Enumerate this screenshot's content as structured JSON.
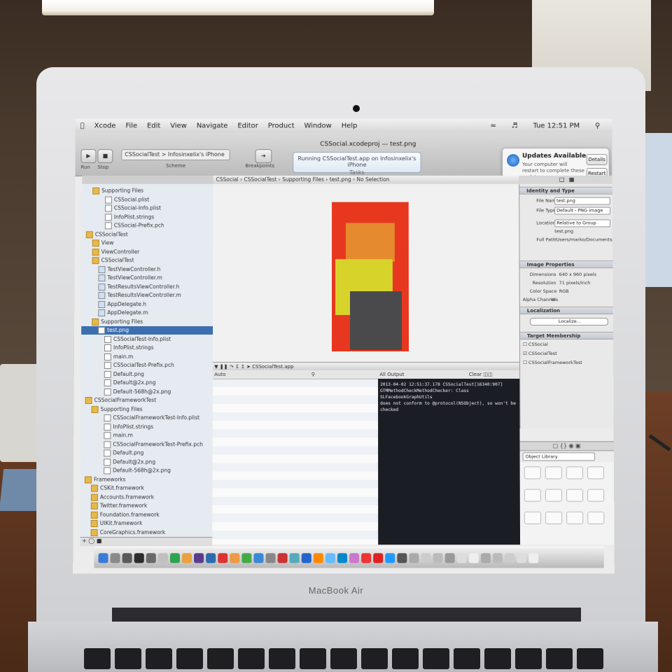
{
  "menubar": {
    "items": [
      "Xcode",
      "File",
      "Edit",
      "View",
      "Navigate",
      "Editor",
      "Product",
      "Window",
      "Help"
    ],
    "status_right": "Tue 12:51 PM"
  },
  "toolbar": {
    "run_label": "Run",
    "stop_label": "Stop",
    "scheme": "CSSocialTest > Infosinxelix's iPhone",
    "scheme_sub": "Scheme",
    "breakpoints_label": "Breakpoints",
    "window_title": "CSSocial.xcodeproj — test.png",
    "activity_text": "Running CSSocialTest.app on Infosinxelix's iPhone",
    "activity_sub": "Tasks"
  },
  "notification": {
    "title": "Updates Available",
    "body": "Your computer will restart to complete these updates.",
    "details_label": "Details",
    "restart_label": "Restart"
  },
  "jumpbar": {
    "crumbs": [
      "CSSocial",
      "CSSocialTest",
      "Supporting Files",
      "test.png",
      "No Selection"
    ]
  },
  "navigator": {
    "rows": [
      {
        "label": "Supporting Files",
        "indent": 1,
        "kind": "folder"
      },
      {
        "label": "CSSocial.plist",
        "indent": 3,
        "kind": "file"
      },
      {
        "label": "CSSocial-Info.plist",
        "indent": 3,
        "kind": "file"
      },
      {
        "label": "InfoPlist.strings",
        "indent": 3,
        "kind": "file"
      },
      {
        "label": "CSSocial-Prefix.pch",
        "indent": 3,
        "kind": "file"
      },
      {
        "label": "CSSocialTest",
        "indent": 0,
        "kind": "folder"
      },
      {
        "label": "View",
        "indent": 1,
        "kind": "folder"
      },
      {
        "label": "ViewController",
        "indent": 1,
        "kind": "folder"
      },
      {
        "label": "CSSocialTest",
        "indent": 1,
        "kind": "folder"
      },
      {
        "label": "TestViewController.h",
        "indent": 2,
        "kind": "hfile"
      },
      {
        "label": "TestViewController.m",
        "indent": 2,
        "kind": "hfile"
      },
      {
        "label": "TestResultsViewController.h",
        "indent": 2,
        "kind": "hfile"
      },
      {
        "label": "TestResultsViewController.m",
        "indent": 2,
        "kind": "hfile"
      },
      {
        "label": "AppDelegate.h",
        "indent": 2,
        "kind": "hfile"
      },
      {
        "label": "AppDelegate.m",
        "indent": 2,
        "kind": "hfile"
      },
      {
        "label": "Supporting Files",
        "indent": 1,
        "kind": "folder"
      },
      {
        "label": "test.png",
        "indent": 2,
        "kind": "file",
        "selected": true
      },
      {
        "label": "CSSocialTest-Info.plist",
        "indent": 3,
        "kind": "file"
      },
      {
        "label": "InfoPlist.strings",
        "indent": 3,
        "kind": "file"
      },
      {
        "label": "main.m",
        "indent": 3,
        "kind": "file"
      },
      {
        "label": "CSSocialTest-Prefix.pch",
        "indent": 3,
        "kind": "file"
      },
      {
        "label": "Default.png",
        "indent": 3,
        "kind": "file"
      },
      {
        "label": "Default@2x.png",
        "indent": 3,
        "kind": "file"
      },
      {
        "label": "Default-568h@2x.png",
        "indent": 3,
        "kind": "file"
      },
      {
        "label": "CSSocialFrameworkTest",
        "indent": 0,
        "kind": "folder"
      },
      {
        "label": "Supporting Files",
        "indent": 1,
        "kind": "folder"
      },
      {
        "label": "CSSocialFrameworkTest-Info.plist",
        "indent": 3,
        "kind": "file"
      },
      {
        "label": "InfoPlist.strings",
        "indent": 3,
        "kind": "file"
      },
      {
        "label": "main.m",
        "indent": 3,
        "kind": "file"
      },
      {
        "label": "CSSocialFrameworkTest-Prefix.pch",
        "indent": 3,
        "kind": "file"
      },
      {
        "label": "Default.png",
        "indent": 3,
        "kind": "file"
      },
      {
        "label": "Default@2x.png",
        "indent": 3,
        "kind": "file"
      },
      {
        "label": "Default-568h@2x.png",
        "indent": 3,
        "kind": "file"
      },
      {
        "label": "Frameworks",
        "indent": 0,
        "kind": "folder"
      },
      {
        "label": "CSKit.framework",
        "indent": 1,
        "kind": "folder"
      },
      {
        "label": "Accounts.framework",
        "indent": 1,
        "kind": "folder"
      },
      {
        "label": "Twitter.framework",
        "indent": 1,
        "kind": "folder"
      },
      {
        "label": "Foundation.framework",
        "indent": 1,
        "kind": "folder"
      },
      {
        "label": "UIKit.framework",
        "indent": 1,
        "kind": "folder"
      },
      {
        "label": "CoreGraphics.framework",
        "indent": 1,
        "kind": "folder"
      }
    ]
  },
  "image_colors": {
    "background": "#e7371f",
    "orange": "#e58a2e",
    "yellow": "#d8d32b",
    "dark": "#4a4a4c"
  },
  "debug": {
    "target": "CSSocialTest.app",
    "vars_filter": "Auto",
    "output_filter": "All Output",
    "clear_label": "Clear",
    "console_lines": [
      "2013-04-02 12:51:37.178 CSSocialTest[16340:907]",
      "GTMMethodCheckMethodChecker: Class SLFacebookGraphUtils",
      "does not conform to @protocol(NSObject), so won't be",
      "checked"
    ]
  },
  "inspector": {
    "identity_header": "Identity and Type",
    "file_name_label": "File Name",
    "file_name": "test.png",
    "file_type_label": "File Type",
    "file_type": "Default - PNG image",
    "location_label": "Location",
    "location": "Relative to Group",
    "location_file": "test.png",
    "full_path_label": "Full Path",
    "full_path": "/Users/marko/Documents/CSLib/CSSocialTest/test.png",
    "image_props_header": "Image Properties",
    "dimensions_label": "Dimensions",
    "dimensions": "640 x 960 pixels",
    "resolution_label": "Resolution",
    "resolution": "71 pixels/inch",
    "color_space_label": "Color Space",
    "color_space": "RGB",
    "alpha_label": "Alpha Channel",
    "alpha": "Yes",
    "localization_header": "Localization",
    "localize_label": "Localize...",
    "target_header": "Target Membership",
    "targets": [
      "CSSocial",
      "CSSocialTest",
      "CSSocialFrameworkTest"
    ]
  },
  "library": {
    "selector": "Object Library"
  },
  "laptop": {
    "brand": "MacBook Air"
  }
}
